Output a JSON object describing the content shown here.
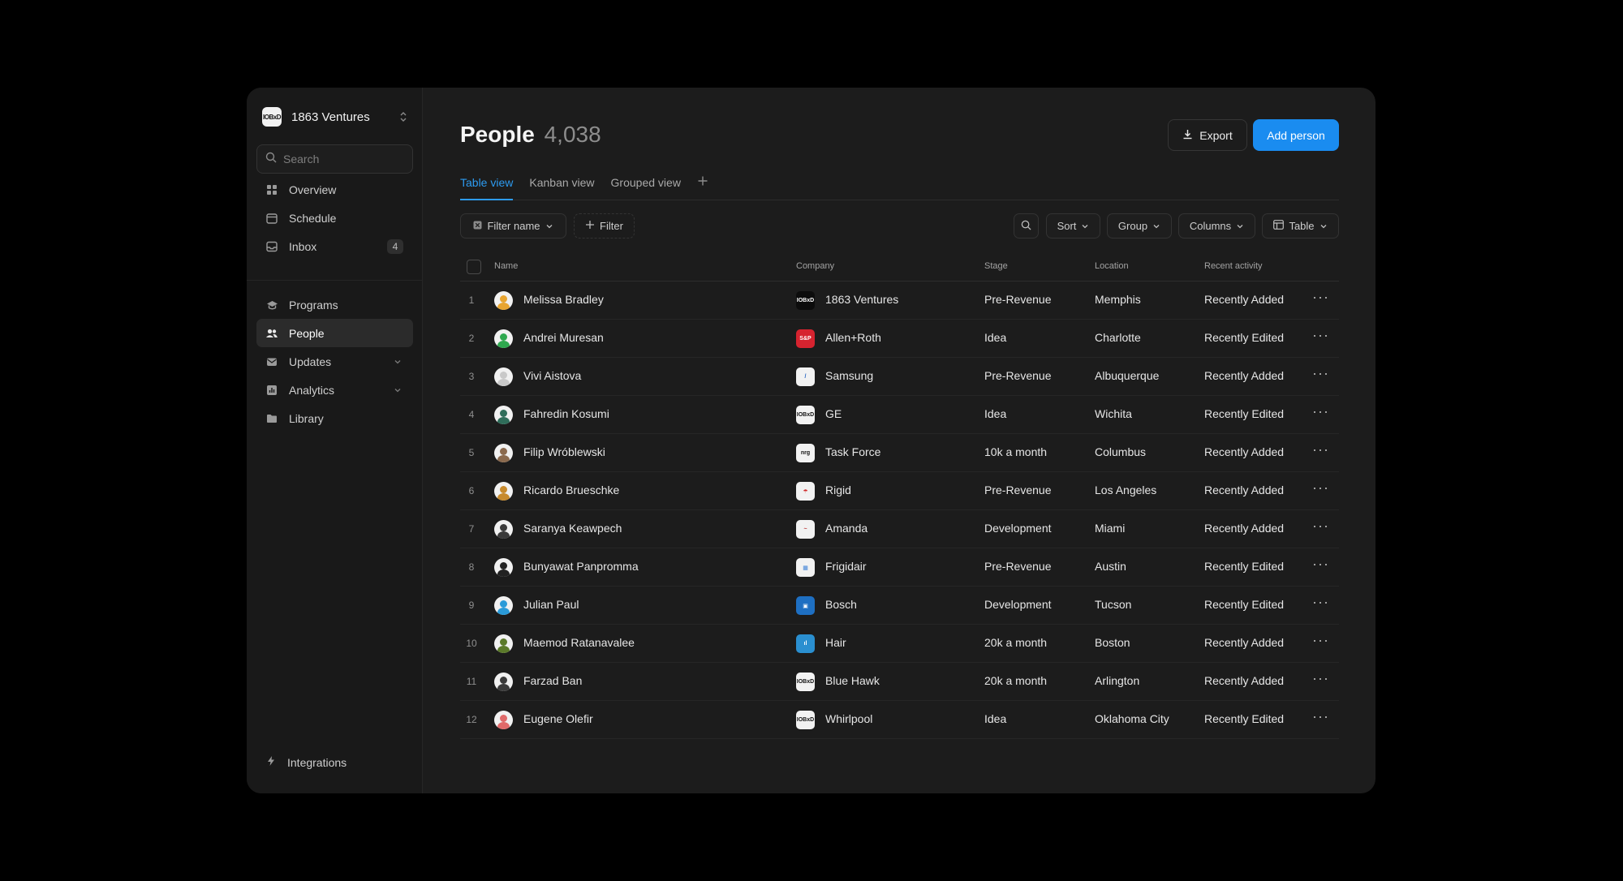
{
  "workspace": {
    "name": "1863 Ventures",
    "logo_text": "IOBxD"
  },
  "search": {
    "placeholder": "Search"
  },
  "sidebar": {
    "items": [
      {
        "label": "Overview",
        "icon": "grid-icon"
      },
      {
        "label": "Schedule",
        "icon": "calendar-icon"
      },
      {
        "label": "Inbox",
        "icon": "inbox-icon",
        "badge": "4"
      },
      {
        "label": "Programs",
        "icon": "graduation-cap-icon"
      },
      {
        "label": "People",
        "icon": "people-icon",
        "active": true
      },
      {
        "label": "Updates",
        "icon": "mail-icon",
        "expandable": true
      },
      {
        "label": "Analytics",
        "icon": "bar-chart-icon",
        "expandable": true
      },
      {
        "label": "Library",
        "icon": "folder-icon"
      }
    ],
    "footer": {
      "label": "Integrations",
      "icon": "lightning-icon"
    }
  },
  "header": {
    "title": "People",
    "count": "4,038",
    "export_label": "Export",
    "add_label": "Add person"
  },
  "tabs": [
    "Table view",
    "Kanban view",
    "Grouped view"
  ],
  "toolbar": {
    "filter_name": "Filter name",
    "filter": "Filter",
    "sort": "Sort",
    "group": "Group",
    "columns": "Columns",
    "table": "Table"
  },
  "table": {
    "columns": [
      "Name",
      "Company",
      "Stage",
      "Location",
      "Recent activity"
    ],
    "rows": [
      {
        "n": "1",
        "name": "Melissa Bradley",
        "company": "1863 Ventures",
        "stage": "Pre-Revenue",
        "location": "Memphis",
        "activity": "Recently Added",
        "logo": "IOBxD",
        "logo_bg": "#0c0c0c",
        "logo_fg": "#ffffff",
        "av": "#e8a530"
      },
      {
        "n": "2",
        "name": "Andrei Muresan",
        "company": "Allen+Roth",
        "stage": "Idea",
        "location": "Charlotte",
        "activity": "Recently Edited",
        "logo": "S&P",
        "logo_bg": "#d6232f",
        "logo_fg": "#ffffff",
        "av": "#2fa84f"
      },
      {
        "n": "3",
        "name": "Vivi Aistova",
        "company": "Samsung",
        "stage": "Pre-Revenue",
        "location": "Albuquerque",
        "activity": "Recently Added",
        "logo": "/",
        "logo_bg": "#f2f2f2",
        "logo_fg": "#1f5fbf",
        "av": "#c9c9c9"
      },
      {
        "n": "4",
        "name": "Fahredin Kosumi",
        "company": "GE",
        "stage": "Idea",
        "location": "Wichita",
        "activity": "Recently Edited",
        "logo": "IOBxD",
        "logo_bg": "#f2f2f2",
        "logo_fg": "#111111",
        "av": "#2f6d5a"
      },
      {
        "n": "5",
        "name": "Filip Wróblewski",
        "company": "Task Force",
        "stage": "10k a month",
        "location": "Columbus",
        "activity": "Recently Added",
        "logo": "nrg",
        "logo_bg": "#f2f2f2",
        "logo_fg": "#111111",
        "av": "#8b6a4e"
      },
      {
        "n": "6",
        "name": "Ricardo Brueschke",
        "company": "Rigid",
        "stage": "Pre-Revenue",
        "location": "Los Angeles",
        "activity": "Recently Added",
        "logo": "☂",
        "logo_bg": "#f2f2f2",
        "logo_fg": "#d12a2a",
        "av": "#c78a2c"
      },
      {
        "n": "7",
        "name": "Saranya Keawpech",
        "company": "Amanda",
        "stage": "Development",
        "location": "Miami",
        "activity": "Recently Added",
        "logo": "~",
        "logo_bg": "#f2f2f2",
        "logo_fg": "#b83a3a",
        "av": "#3a3a3a"
      },
      {
        "n": "8",
        "name": "Bunyawat Panpromma",
        "company": "Frigidair",
        "stage": "Pre-Revenue",
        "location": "Austin",
        "activity": "Recently Edited",
        "logo": "▦",
        "logo_bg": "#f2f2f2",
        "logo_fg": "#3a7fd6",
        "av": "#222222"
      },
      {
        "n": "9",
        "name": "Julian Paul",
        "company": "Bosch",
        "stage": "Development",
        "location": "Tucson",
        "activity": "Recently Edited",
        "logo": "▣",
        "logo_bg": "#1e6fc2",
        "logo_fg": "#ffffff",
        "av": "#2a9ad8"
      },
      {
        "n": "10",
        "name": "Maemod Ratanavalee",
        "company": "Hair",
        "stage": "20k a month",
        "location": "Boston",
        "activity": "Recently Added",
        "logo": "ıl",
        "logo_bg": "#2a8fd0",
        "logo_fg": "#ffffff",
        "av": "#5b7a2a"
      },
      {
        "n": "11",
        "name": "Farzad Ban",
        "company": "Blue Hawk",
        "stage": "20k a month",
        "location": "Arlington",
        "activity": "Recently Added",
        "logo": "IOBxD",
        "logo_bg": "#f2f2f2",
        "logo_fg": "#111111",
        "av": "#3b3b3b"
      },
      {
        "n": "12",
        "name": "Eugene Olefir",
        "company": "Whirlpool",
        "stage": "Idea",
        "location": "Oklahoma City",
        "activity": "Recently Edited",
        "logo": "IOBxD",
        "logo_bg": "#f2f2f2",
        "logo_fg": "#111111",
        "av": "#e06a6a"
      }
    ]
  },
  "colors": {
    "accent": "#1a8cf0",
    "background": "#1c1c1c",
    "sidebar": "#191919"
  }
}
